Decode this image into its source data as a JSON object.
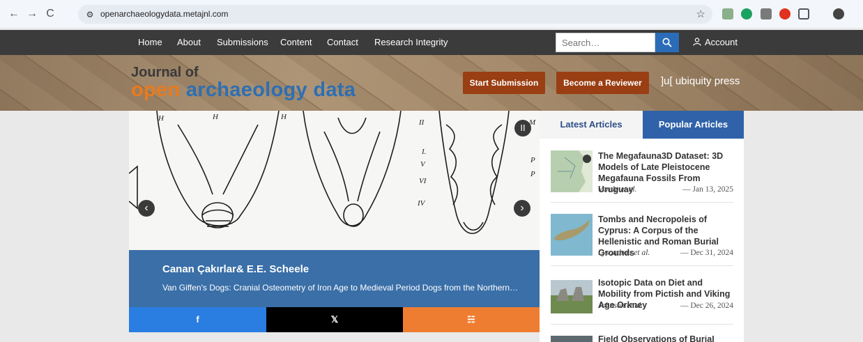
{
  "browser": {
    "url": "openarchaeologydata.metajnl.com",
    "back_icon": "←",
    "forward_icon": "→",
    "reload_icon": "C",
    "site_info_icon": "⚙",
    "bookmark_icon": "☆"
  },
  "nav": {
    "items": [
      "Home",
      "About",
      "Submissions",
      "Content",
      "Contact",
      "Research Integrity"
    ],
    "search_placeholder": "Search…",
    "account_label": "Account"
  },
  "banner": {
    "logo_line1": "Journal of",
    "logo_open": "open",
    "logo_rest": " archaeology data",
    "start_submission": "Start Submission",
    "become_reviewer": "Become a Reviewer",
    "publisher": "]u[ ubiquity press",
    "colors": {
      "open": "#e87a1f",
      "archaeology": "#2e6fb2",
      "button": "#9a3e13"
    }
  },
  "carousel": {
    "authors": "Canan Çakırlar& E.E. Scheele",
    "title": "Van Giffen's Dogs: Cranial Osteometry of Iron Age to Medieval Period Dogs from the Northern…",
    "prev_icon": "‹",
    "next_icon": "›",
    "pause_icon": "II"
  },
  "share": {
    "facebook": "f",
    "x": "𝕏",
    "rss": "☵",
    "colors": {
      "facebook": "#2a7de1",
      "x": "#000000",
      "rss": "#ef7d31"
    }
  },
  "sidebar": {
    "tab_latest": "Latest Articles",
    "tab_popular": "Popular Articles",
    "articles": [
      {
        "title": "The Megafauna3D Dataset: 3D Models of Late Pleistocene Megafauna Fossils From Uruguay",
        "authors": "Varela et al.",
        "date": "— Jan 13, 2025"
      },
      {
        "title": "Tombs and Necropoleis of Cyprus: A Corpus of the Hellenistic and Roman Burial Grounds",
        "authors": "Lysandrou et al.",
        "date": "— Dec 31, 2024"
      },
      {
        "title": "Isotopic Data on Diet and Mobility from Pictish and Viking Age Orkney",
        "authors": "Johnson et al.",
        "date": "— Dec 26, 2024"
      },
      {
        "title": "Field Observations of Burial",
        "authors": "",
        "date": ""
      }
    ]
  }
}
